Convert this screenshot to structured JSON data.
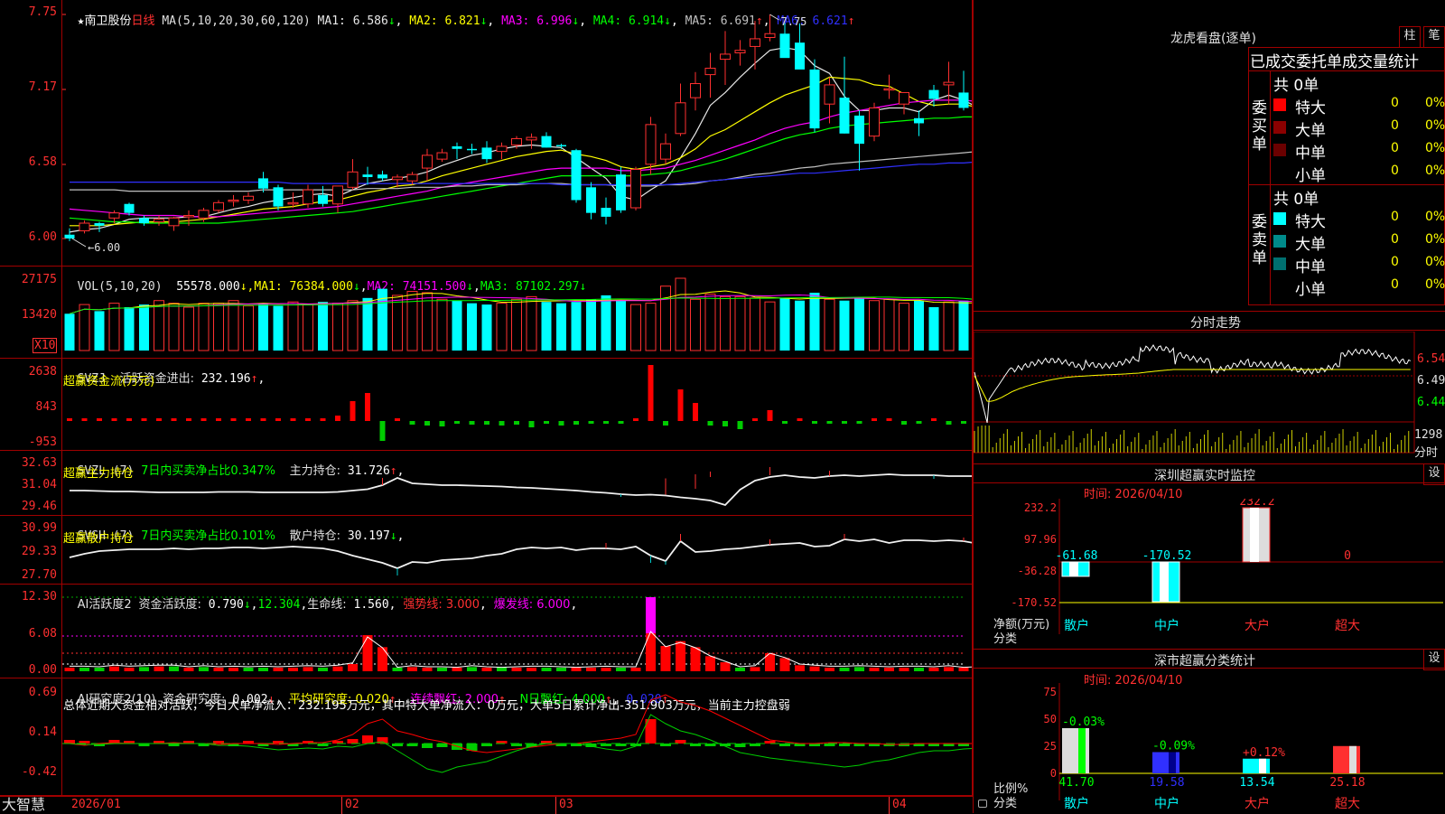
{
  "main": {
    "star": "★",
    "stock_name": "南卫股份",
    "period": "日线",
    "ma_title": "MA(5,10,20,30,60,120)",
    "ma": [
      {
        "label": "MA1:",
        "value": "6.586",
        "arrow": "↓",
        "color": "#e8e8e8"
      },
      {
        "label": "MA2:",
        "value": "6.821",
        "arrow": "↓",
        "color": "#ffff00"
      },
      {
        "label": "MA3:",
        "value": "6.996",
        "arrow": "↓",
        "color": "#ff00ff"
      },
      {
        "label": "MA4:",
        "value": "6.914",
        "arrow": "↓",
        "color": "#00ff00"
      },
      {
        "label": "MA5:",
        "value": "6.691",
        "arrow": "↑",
        "color": "#c0c0c0"
      },
      {
        "label": "MA6:",
        "value": "6.621",
        "arrow": "↑",
        "color": "#3030ff"
      }
    ],
    "high_mark": "7.75",
    "low_mark": "6.00",
    "yticks": [
      "7.75",
      "7.17",
      "6.58",
      "6.00"
    ]
  },
  "vol": {
    "title": "VOL(5,10,20)",
    "value": "55578.000",
    "ma": [
      {
        "label": "MA1:",
        "value": "76384.000",
        "arrow": "↓",
        "color": "#ffff00"
      },
      {
        "label": "MA2:",
        "value": "74151.500",
        "arrow": "↓",
        "color": "#ff00ff"
      },
      {
        "label": "MA3:",
        "value": "87102.297",
        "arrow": "↓",
        "color": "#00ff00"
      }
    ],
    "yticks": [
      "27175",
      "13420"
    ],
    "unit": "X10"
  },
  "svzj": {
    "title": "SVZJ",
    "label": "活跃资金进出:",
    "value": "232.196",
    "arrow": "↑",
    "sub": "超赢资金流(万元)",
    "yticks": [
      "2638",
      "843",
      "-953"
    ]
  },
  "svzl": {
    "title": "SVZL (7)",
    "ratio": "7日内买卖净占比0.347%",
    "label": "主力持仓:",
    "value": "31.726",
    "arrow": "↑",
    "sub": "超赢主力持仓",
    "yticks": [
      "32.63",
      "31.04",
      "29.46"
    ]
  },
  "svsh": {
    "title": "SVSH (7)",
    "ratio": "7日内买卖净占比0.101%",
    "label": "散户持仓:",
    "value": "30.197",
    "arrow": "↓",
    "sub": "超赢散户持仓",
    "yticks": [
      "30.99",
      "29.33",
      "27.70"
    ]
  },
  "ai1": {
    "title": "AI活跃度2",
    "label": "资金活跃度:",
    "value": "0.790",
    "v2": "12.304",
    "life_label": "生命线:",
    "life": "1.560",
    "strong": "强势线: 3.000",
    "burst": "爆发线: 6.000",
    "yticks": [
      "12.30",
      "6.08",
      "0.00"
    ]
  },
  "ai2": {
    "title": "AI研究度2(10)",
    "label": "资金研究度:",
    "value": "0.002",
    "avg": "平均研究度: 0.020",
    "cont": "连续飘红: 2.000",
    "nday": "N日飘红: 4.000",
    "last": "0.020",
    "summary": "总体近期大资金相对活跃，今日大单净流入：232.195万元，其中特大单净流入：0万元，大单5日累计净出-351.903万元，当前主力控盘弱",
    "yticks": [
      "0.69",
      "0.14",
      "-0.42"
    ]
  },
  "xaxis": {
    "brand": "大智慧",
    "labels": [
      "2026/01",
      "02",
      "03",
      "04"
    ]
  },
  "lhb": {
    "title": "龙虎看盘(逐单)",
    "btn1": "柱",
    "btn2": "笔",
    "subtitle": "已成交委托单成交量统计",
    "buy_side": "委买单",
    "sell_side": "委卖单",
    "buy_total": "共 0单",
    "sell_total": "共 0单",
    "buy_rows": [
      {
        "name": "特大",
        "count": "0",
        "pct": "0%",
        "color": "#ff0000"
      },
      {
        "name": "大单",
        "count": "0",
        "pct": "0%",
        "color": "#8b0000"
      },
      {
        "name": "中单",
        "count": "0",
        "pct": "0%",
        "color": "#6b0000"
      },
      {
        "name": "小单",
        "count": "0",
        "pct": "0%",
        "color": "#000000"
      }
    ],
    "sell_rows": [
      {
        "name": "特大",
        "count": "0",
        "pct": "0%",
        "color": "#00ffff"
      },
      {
        "name": "大单",
        "count": "0",
        "pct": "0%",
        "color": "#008b8b"
      },
      {
        "name": "中单",
        "count": "0",
        "pct": "0%",
        "color": "#007070"
      },
      {
        "name": "小单",
        "count": "0",
        "pct": "0%",
        "color": "#000000"
      }
    ]
  },
  "fenshi": {
    "title": "分时走势",
    "yticks": [
      "6.54",
      "6.49",
      "6.44"
    ],
    "vol_tick": "1298",
    "vol_label": "分时"
  },
  "szmon": {
    "title": "深圳超赢实时监控",
    "btn": "设",
    "time": "时间: 2026/04/10",
    "yticks": [
      "232.2",
      "97.96",
      "-36.28",
      "-170.52"
    ],
    "ylabel1": "净额(万元)",
    "ylabel2": "分类",
    "values": [
      "-61.68",
      "-170.52",
      "232.2",
      "0"
    ],
    "cats": [
      "散户",
      "中户",
      "大户",
      "超大"
    ]
  },
  "szcls": {
    "title": "深市超赢分类统计",
    "btn": "设",
    "time": "时间: 2026/04/10",
    "yticks": [
      "75",
      "50",
      "25",
      "0"
    ],
    "ylabel1": "比例%",
    "ylabel2": "分类",
    "changes": [
      "-0.03%",
      "-0.09%",
      "+0.12%",
      ""
    ],
    "values": [
      "41.70",
      "19.58",
      "13.54",
      "25.18"
    ],
    "cats": [
      "散户",
      "中户",
      "大户",
      "超大"
    ]
  },
  "colors": {
    "up": "#ff3030",
    "down": "#00ffff",
    "grid": "#a00000",
    "axis": "#ff3030"
  },
  "chart_data": {
    "type": "candlestick",
    "title": "",
    "ohlc": [
      [
        6.03,
        6.08,
        5.98,
        6.0
      ],
      [
        6.06,
        6.14,
        6.04,
        6.12
      ],
      [
        6.12,
        6.13,
        6.05,
        6.1
      ],
      [
        6.16,
        6.22,
        6.12,
        6.2
      ],
      [
        6.27,
        6.28,
        6.18,
        6.2
      ],
      [
        6.16,
        6.18,
        6.1,
        6.12
      ],
      [
        6.13,
        6.18,
        6.1,
        6.15
      ],
      [
        6.1,
        6.17,
        6.06,
        6.16
      ],
      [
        6.17,
        6.22,
        6.1,
        6.18
      ],
      [
        6.16,
        6.24,
        6.13,
        6.22
      ],
      [
        6.22,
        6.3,
        6.2,
        6.28
      ],
      [
        6.29,
        6.34,
        6.25,
        6.3
      ],
      [
        6.3,
        6.36,
        6.27,
        6.33
      ],
      [
        6.47,
        6.52,
        6.36,
        6.39
      ],
      [
        6.4,
        6.42,
        6.22,
        6.25
      ],
      [
        6.27,
        6.36,
        6.24,
        6.28
      ],
      [
        6.27,
        6.42,
        6.24,
        6.38
      ],
      [
        6.34,
        6.41,
        6.25,
        6.27
      ],
      [
        6.27,
        6.41,
        6.2,
        6.41
      ],
      [
        6.4,
        6.62,
        6.38,
        6.52
      ],
      [
        6.5,
        6.56,
        6.42,
        6.48
      ],
      [
        6.5,
        6.53,
        6.45,
        6.47
      ],
      [
        6.46,
        6.5,
        6.4,
        6.48
      ],
      [
        6.45,
        6.52,
        6.42,
        6.5
      ],
      [
        6.55,
        6.7,
        6.45,
        6.65
      ],
      [
        6.62,
        6.7,
        6.6,
        6.67
      ],
      [
        6.72,
        6.75,
        6.62,
        6.7
      ],
      [
        6.7,
        6.74,
        6.66,
        6.69
      ],
      [
        6.71,
        6.76,
        6.59,
        6.62
      ],
      [
        6.68,
        6.75,
        6.62,
        6.72
      ],
      [
        6.73,
        6.8,
        6.7,
        6.78
      ],
      [
        6.77,
        6.82,
        6.7,
        6.79
      ],
      [
        6.8,
        6.83,
        6.71,
        6.71
      ],
      [
        6.73,
        6.74,
        6.7,
        6.72
      ],
      [
        6.69,
        6.7,
        6.28,
        6.3
      ],
      [
        6.4,
        6.44,
        6.15,
        6.2
      ],
      [
        6.24,
        6.32,
        6.11,
        6.17
      ],
      [
        6.5,
        6.56,
        6.2,
        6.22
      ],
      [
        6.24,
        6.56,
        6.22,
        6.54
      ],
      [
        6.58,
        6.95,
        6.5,
        6.89
      ],
      [
        6.62,
        6.82,
        6.58,
        6.74
      ],
      [
        6.82,
        7.21,
        6.8,
        7.06
      ],
      [
        7.1,
        7.3,
        7.0,
        7.21
      ],
      [
        7.28,
        7.45,
        7.1,
        7.33
      ],
      [
        7.4,
        7.62,
        7.2,
        7.44
      ],
      [
        7.45,
        7.55,
        7.35,
        7.47
      ],
      [
        7.5,
        7.7,
        7.32,
        7.56
      ],
      [
        7.57,
        7.75,
        7.54,
        7.6
      ],
      [
        7.6,
        7.68,
        7.42,
        7.41
      ],
      [
        7.53,
        7.68,
        7.34,
        7.32
      ],
      [
        7.32,
        7.4,
        6.83,
        6.86
      ],
      [
        7.05,
        7.26,
        6.9,
        7.2
      ],
      [
        7.1,
        7.42,
        6.82,
        6.82
      ],
      [
        6.96,
        7.0,
        6.53,
        6.74
      ],
      [
        6.8,
        7.06,
        6.76,
        7.02
      ],
      [
        7.16,
        7.28,
        7.09,
        7.17
      ],
      [
        7.05,
        7.14,
        6.97,
        7.14
      ],
      [
        6.94,
        7.0,
        6.8,
        6.9
      ],
      [
        7.16,
        7.2,
        7.03,
        7.09
      ],
      [
        7.2,
        7.38,
        7.05,
        7.22
      ],
      [
        7.14,
        7.31,
        7.0,
        7.02
      ],
      [
        7.05,
        7.23,
        6.7,
        6.75
      ],
      [
        6.74,
        6.79,
        6.6,
        6.59
      ],
      [
        6.63,
        6.77,
        6.42,
        6.42
      ],
      [
        6.62,
        6.75,
        6.45,
        6.67
      ],
      [
        6.78,
        6.85,
        6.63,
        6.73
      ],
      [
        6.84,
        6.84,
        6.5,
        6.5
      ],
      [
        6.61,
        6.64,
        6.46,
        6.61
      ]
    ],
    "ma": {
      "MA1": [
        6.05,
        6.07,
        6.08,
        6.11,
        6.15,
        6.16,
        6.16,
        6.16,
        6.17,
        6.17,
        6.2,
        6.23,
        6.25,
        6.28,
        6.3,
        6.32,
        6.34,
        6.35,
        6.33,
        6.38,
        6.43,
        6.45,
        6.47,
        6.49,
        6.52,
        6.57,
        6.61,
        6.65,
        6.67,
        6.7,
        6.72,
        6.73,
        6.72,
        6.71,
        6.63,
        6.55,
        6.47,
        6.33,
        6.3,
        6.38,
        6.45,
        6.63,
        6.82,
        7.04,
        7.14,
        7.26,
        7.37,
        7.47,
        7.49,
        7.47,
        7.35,
        7.29,
        7.11,
        7.0,
        7.0,
        7.02,
        7.02,
        6.99,
        7.08,
        7.12,
        7.08,
        7.02,
        6.94,
        6.81,
        6.69,
        6.63,
        6.62,
        6.59
      ],
      "MA2": [
        6.1,
        6.1,
        6.1,
        6.11,
        6.12,
        6.13,
        6.13,
        6.13,
        6.14,
        6.15,
        6.17,
        6.19,
        6.21,
        6.23,
        6.24,
        6.25,
        6.27,
        6.29,
        6.3,
        6.33,
        6.36,
        6.38,
        6.41,
        6.42,
        6.45,
        6.49,
        6.52,
        6.55,
        6.58,
        6.61,
        6.64,
        6.66,
        6.68,
        6.69,
        6.66,
        6.64,
        6.61,
        6.56,
        6.54,
        6.56,
        6.58,
        6.63,
        6.7,
        6.8,
        6.85,
        6.92,
        6.99,
        7.06,
        7.12,
        7.16,
        7.2,
        7.26,
        7.25,
        7.24,
        7.2,
        7.19,
        7.13,
        7.07,
        7.04,
        7.05,
        7.05,
        7.02,
        6.98,
        6.94,
        6.92,
        6.9,
        6.88,
        6.85
      ],
      "MA3": [
        6.23,
        6.22,
        6.21,
        6.2,
        6.19,
        6.18,
        6.18,
        6.18,
        6.17,
        6.17,
        6.17,
        6.18,
        6.19,
        6.2,
        6.21,
        6.22,
        6.23,
        6.24,
        6.25,
        6.27,
        6.29,
        6.31,
        6.33,
        6.35,
        6.37,
        6.4,
        6.42,
        6.44,
        6.46,
        6.48,
        6.5,
        6.52,
        6.54,
        6.55,
        6.55,
        6.55,
        6.55,
        6.53,
        6.53,
        6.54,
        6.55,
        6.58,
        6.61,
        6.65,
        6.69,
        6.73,
        6.77,
        6.82,
        6.86,
        6.89,
        6.91,
        6.95,
        6.98,
        7.0,
        7.02,
        7.04,
        7.06,
        7.07,
        7.08,
        7.08,
        7.08,
        7.07,
        7.06,
        7.04,
        7.03,
        7.02,
        7.01,
        7.0
      ],
      "MA4": [
        6.16,
        6.15,
        6.14,
        6.13,
        6.13,
        6.12,
        6.12,
        6.12,
        6.12,
        6.12,
        6.12,
        6.13,
        6.14,
        6.15,
        6.16,
        6.17,
        6.18,
        6.19,
        6.2,
        6.21,
        6.23,
        6.25,
        6.27,
        6.29,
        6.31,
        6.33,
        6.35,
        6.37,
        6.39,
        6.41,
        6.43,
        6.45,
        6.47,
        6.49,
        6.49,
        6.49,
        6.49,
        6.49,
        6.49,
        6.5,
        6.51,
        6.53,
        6.56,
        6.59,
        6.62,
        6.66,
        6.7,
        6.74,
        6.78,
        6.81,
        6.83,
        6.86,
        6.88,
        6.89,
        6.9,
        6.91,
        6.92,
        6.93,
        6.94,
        6.94,
        6.95,
        6.95,
        6.95,
        6.94,
        6.94,
        6.93,
        6.92,
        6.91
      ],
      "MA5": [
        6.38,
        6.38,
        6.38,
        6.38,
        6.37,
        6.37,
        6.37,
        6.37,
        6.37,
        6.37,
        6.37,
        6.37,
        6.37,
        6.38,
        6.38,
        6.38,
        6.38,
        6.38,
        6.38,
        6.38,
        6.39,
        6.39,
        6.39,
        6.4,
        6.4,
        6.4,
        6.41,
        6.41,
        6.42,
        6.42,
        6.42,
        6.43,
        6.43,
        6.43,
        6.42,
        6.42,
        6.42,
        6.41,
        6.41,
        6.41,
        6.42,
        6.42,
        6.43,
        6.45,
        6.46,
        6.48,
        6.5,
        6.51,
        6.53,
        6.55,
        6.56,
        6.58,
        6.59,
        6.6,
        6.61,
        6.62,
        6.63,
        6.64,
        6.65,
        6.66,
        6.67,
        6.68,
        6.68,
        6.68,
        6.69,
        6.69,
        6.69,
        6.69
      ],
      "MA6": [
        6.44,
        6.44,
        6.44,
        6.44,
        6.44,
        6.44,
        6.44,
        6.44,
        6.44,
        6.44,
        6.44,
        6.44,
        6.44,
        6.44,
        6.44,
        6.43,
        6.43,
        6.43,
        6.43,
        6.43,
        6.43,
        6.43,
        6.43,
        6.43,
        6.43,
        6.43,
        6.43,
        6.43,
        6.43,
        6.43,
        6.43,
        6.43,
        6.43,
        6.42,
        6.42,
        6.42,
        6.42,
        6.42,
        6.42,
        6.42,
        6.42,
        6.43,
        6.44,
        6.45,
        6.46,
        6.47,
        6.48,
        6.49,
        6.5,
        6.51,
        6.51,
        6.52,
        6.53,
        6.54,
        6.55,
        6.56,
        6.57,
        6.58,
        6.58,
        6.59,
        6.59,
        6.6,
        6.6,
        6.6,
        6.61,
        6.61,
        6.62,
        6.62
      ]
    },
    "volume": [
      2800,
      3500,
      3000,
      3600,
      3300,
      3500,
      3800,
      3600,
      3300,
      3600,
      3600,
      3800,
      3400,
      3600,
      3400,
      3700,
      3500,
      3700,
      3600,
      3800,
      4000,
      4700,
      4200,
      4500,
      4400,
      3900,
      3800,
      3600,
      3500,
      3600,
      3900,
      4100,
      3700,
      3600,
      3700,
      3900,
      4200,
      3800,
      3500,
      3600,
      4900,
      5500,
      3900,
      4300,
      4100,
      4100,
      4000,
      3700,
      4000,
      3800,
      4400,
      3900,
      3800,
      4000,
      3800,
      3900,
      3600,
      3800,
      3300,
      3700,
      3800,
      3500,
      3900,
      3700,
      3800,
      3600,
      4000,
      4100
    ],
    "xlabels": [
      "2026/01",
      "02",
      "03",
      "04"
    ]
  }
}
